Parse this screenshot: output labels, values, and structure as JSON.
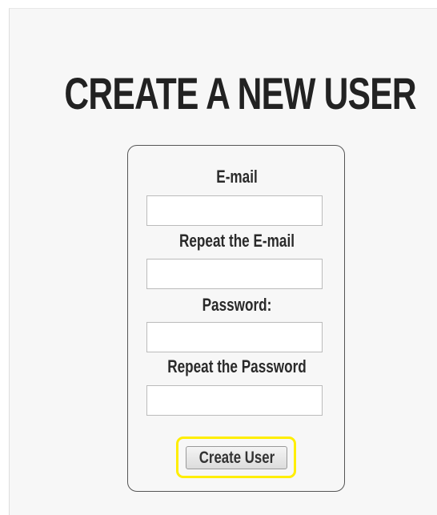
{
  "page": {
    "title": "CREATE A NEW USER"
  },
  "form": {
    "email_label": "E-mail",
    "email_value": "",
    "repeat_email_label": "Repeat the E-mail",
    "repeat_email_value": "",
    "password_label": "Password:",
    "password_value": "",
    "repeat_password_label": "Repeat the Password",
    "repeat_password_value": "",
    "submit_label": "Create User"
  },
  "colors": {
    "highlight": "#ffee00",
    "panel_background": "#f7f7f7",
    "text": "#222222"
  }
}
